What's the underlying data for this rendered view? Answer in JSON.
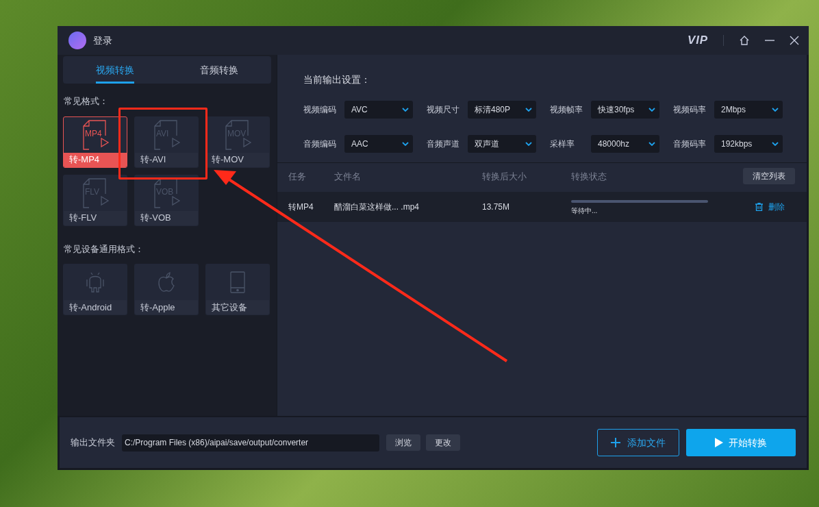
{
  "window": {
    "login_label": "登录",
    "vip_label": "VIP"
  },
  "tabs": [
    {
      "label": "视频转换",
      "selected": true
    },
    {
      "label": "音频转换",
      "selected": false
    }
  ],
  "format_sections": [
    {
      "title": "常见格式：",
      "items": [
        {
          "label": "转-MP4",
          "kind": "file",
          "icon_text": "MP4",
          "selected": true,
          "highlighted": false
        },
        {
          "label": "转-AVI",
          "kind": "file",
          "icon_text": "AVI",
          "selected": false,
          "highlighted": true
        },
        {
          "label": "转-MOV",
          "kind": "file",
          "icon_text": "MOV",
          "selected": false,
          "highlighted": false
        },
        {
          "label": "转-FLV",
          "kind": "file",
          "icon_text": "FLV",
          "selected": false,
          "highlighted": false
        },
        {
          "label": "转-VOB",
          "kind": "file",
          "icon_text": "VOB",
          "selected": false,
          "highlighted": false
        }
      ]
    },
    {
      "title": "常见设备通用格式：",
      "items": [
        {
          "label": "转-Android",
          "kind": "android",
          "selected": false,
          "highlighted": false
        },
        {
          "label": "转-Apple",
          "kind": "apple",
          "selected": false,
          "highlighted": false
        },
        {
          "label": "其它设备",
          "kind": "device",
          "selected": false,
          "highlighted": false
        }
      ]
    }
  ],
  "output_settings": {
    "title": "当前输出设置：",
    "fields": [
      {
        "label": "视频编码",
        "value": "AVC"
      },
      {
        "label": "视频尺寸",
        "value": "标清480P"
      },
      {
        "label": "视频帧率",
        "value": "快速30fps"
      },
      {
        "label": "视频码率",
        "value": "2Mbps"
      },
      {
        "label": "音频编码",
        "value": "AAC"
      },
      {
        "label": "音频声道",
        "value": "双声道"
      },
      {
        "label": "采样率",
        "value": "48000hz"
      },
      {
        "label": "音频码率",
        "value": "192kbps"
      }
    ]
  },
  "task_table": {
    "columns": [
      "任务",
      "文件名",
      "转换后大小",
      "转换状态"
    ],
    "clear_button": "清空列表",
    "rows": [
      {
        "task": "转MP4",
        "file_name": "醋溜白菜这样做... .mp4",
        "size": "13.75M",
        "status": "等待中...",
        "delete_label": "删除"
      }
    ]
  },
  "output_folder": {
    "label": "输出文件夹",
    "path": "C:/Program Files (x86)/aipai/save/output/converter",
    "buttons": [
      "浏览",
      "更改"
    ]
  },
  "actions": [
    {
      "label": "添加文件",
      "kind": "secondary"
    },
    {
      "label": "开始转换",
      "kind": "primary"
    }
  ]
}
